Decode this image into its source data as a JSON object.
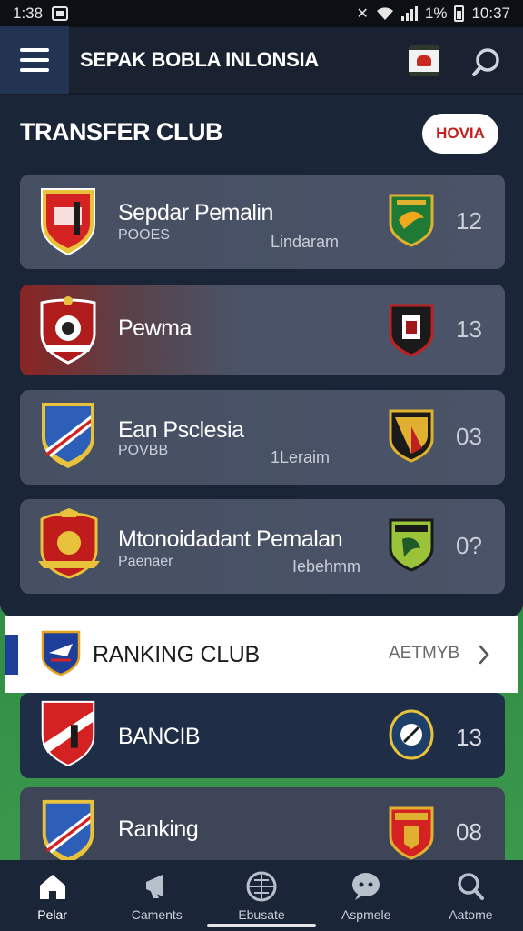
{
  "status_bar": {
    "time": "1:38",
    "battery_text": "1%",
    "clock": "10:37"
  },
  "app_bar": {
    "title": "SEPAK BOBLA INLONSIA"
  },
  "transfer": {
    "title": "TRANSFER CLUB",
    "button_label": "HOVIA",
    "cards": [
      {
        "name": "Sepdar Pemalin",
        "sub": "POOES",
        "venue": "Lindaram",
        "score": "12"
      },
      {
        "name": "Pewma",
        "sub": "",
        "venue": "",
        "score": "13"
      },
      {
        "name": "Ean Psclesia",
        "sub": "POVBB",
        "venue": "1Leraim",
        "score": "03"
      },
      {
        "name": "Mtonoidadant Pemalan",
        "sub": "Paenaer",
        "venue": "Iebehmm",
        "score": "0?"
      }
    ]
  },
  "ranking": {
    "title": "RANKING CLUB",
    "more_label": "AETMYB",
    "cards": [
      {
        "name": "BANCIB",
        "score": "13"
      },
      {
        "name": "Ranking",
        "score": "08"
      }
    ]
  },
  "bottom_nav": {
    "items": [
      {
        "label": "Pelar",
        "icon": "home-icon"
      },
      {
        "label": "Caments",
        "icon": "megaphone-icon"
      },
      {
        "label": "Ebusate",
        "icon": "ball-icon"
      },
      {
        "label": "Aspmele",
        "icon": "chat-icon"
      },
      {
        "label": "Aatome",
        "icon": "search-icon"
      }
    ]
  },
  "colors": {
    "panel": "#1a2538",
    "card": "#4a5367",
    "accent_red": "#c42020",
    "nav_blue": "#1f2d47"
  }
}
